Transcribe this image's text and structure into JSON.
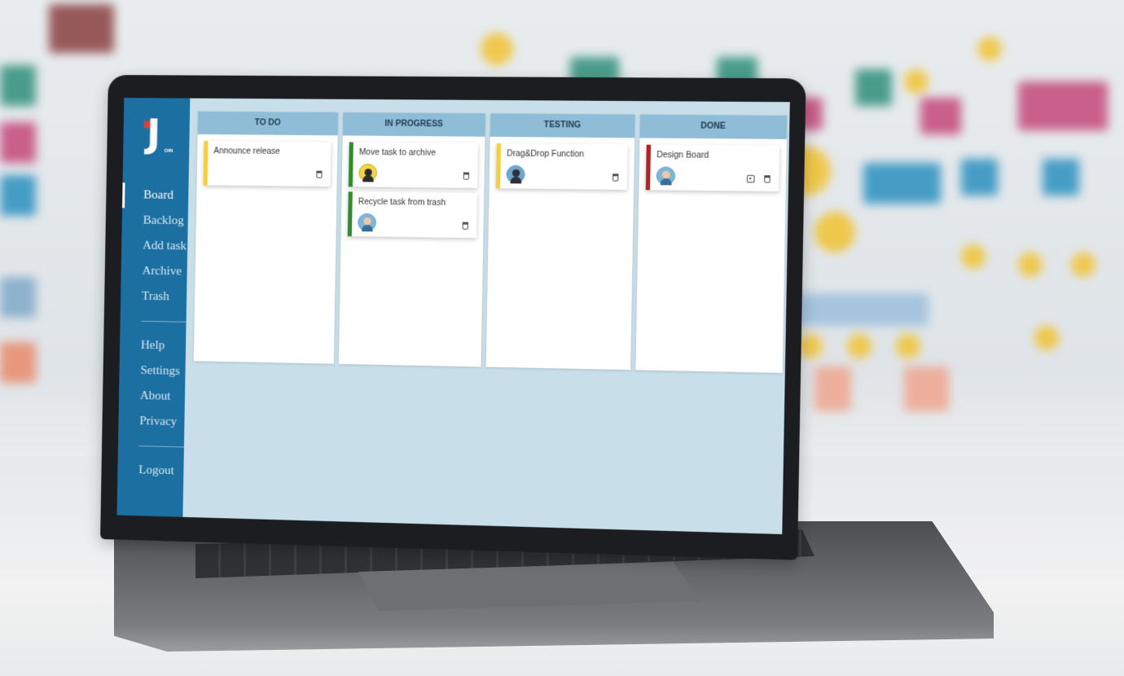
{
  "app": {
    "logo_text": "J",
    "logo_sub": "OIN"
  },
  "sidebar": {
    "items": [
      {
        "label": "Board",
        "active": true
      },
      {
        "label": "Backlog",
        "active": false
      },
      {
        "label": "Add task",
        "active": false
      },
      {
        "label": "Archive",
        "active": false
      },
      {
        "label": "Trash",
        "active": false
      }
    ],
    "secondary": [
      {
        "label": "Help"
      },
      {
        "label": "Settings"
      },
      {
        "label": "About"
      },
      {
        "label": "Privacy"
      }
    ],
    "logout_label": "Logout"
  },
  "board": {
    "columns": [
      {
        "title": "TO DO",
        "cards": [
          {
            "title": "Announce release",
            "color": "#f4d03f",
            "avatar": "",
            "actions": [
              "trash-icon"
            ]
          }
        ]
      },
      {
        "title": "IN PROGRESS",
        "cards": [
          {
            "title": "Move task to archive",
            "color": "#2e8b2e",
            "avatar": "bee",
            "actions": [
              "trash-icon"
            ]
          },
          {
            "title": "Recycle task from trash",
            "color": "#2e8b2e",
            "avatar": "person",
            "actions": [
              "trash-icon"
            ]
          }
        ]
      },
      {
        "title": "TESTING",
        "cards": [
          {
            "title": "Drag&Drop Function",
            "color": "#f4d03f",
            "avatar": "ninja",
            "actions": [
              "trash-icon"
            ]
          }
        ]
      },
      {
        "title": "DONE",
        "cards": [
          {
            "title": "Design Board",
            "color": "#b22222",
            "avatar": "person",
            "actions": [
              "archive-icon",
              "trash-icon"
            ]
          }
        ]
      }
    ]
  },
  "colors": {
    "sidebar": "#1b6fa1",
    "board_bg": "#c8dfe9",
    "column_header": "#8fbdd8",
    "logo_accent": "#e53935"
  }
}
